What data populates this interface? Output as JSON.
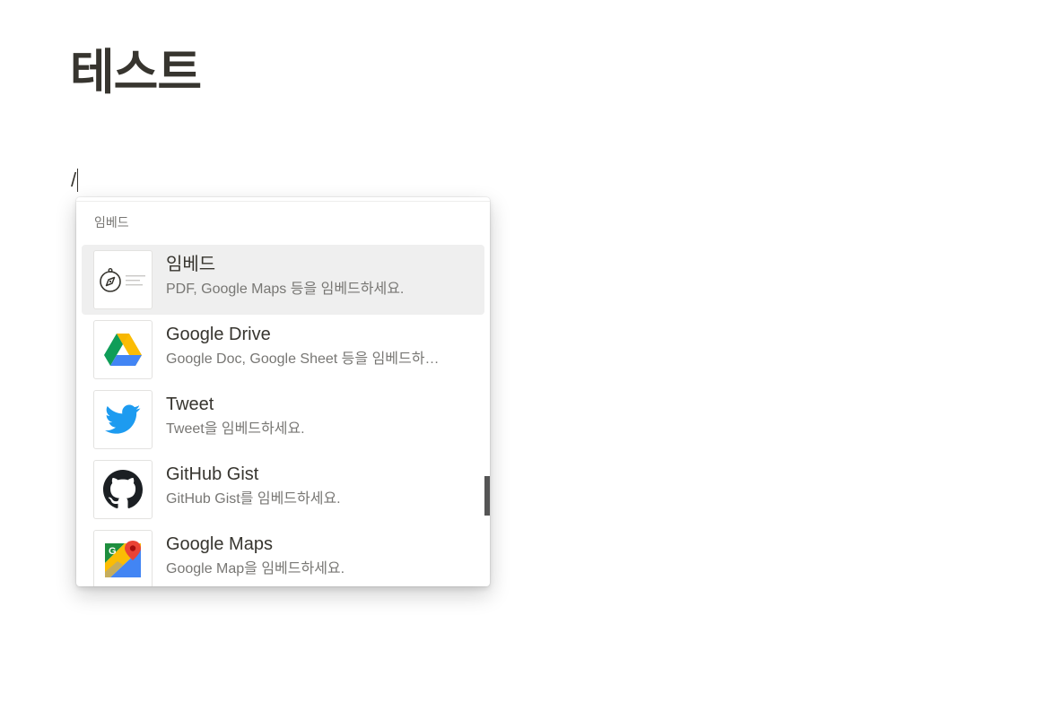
{
  "page": {
    "title": "테스트",
    "input_text": "/"
  },
  "menu": {
    "section_label": "임베드",
    "items": [
      {
        "icon": "embed-compass-icon",
        "title": "임베드",
        "description": "PDF, Google Maps 등을 임베드하세요.",
        "selected": true
      },
      {
        "icon": "google-drive-icon",
        "title": "Google Drive",
        "description": "Google Doc, Google Sheet 등을 임베드하…",
        "selected": false
      },
      {
        "icon": "twitter-bird-icon",
        "title": "Tweet",
        "description": "Tweet을 임베드하세요.",
        "selected": false
      },
      {
        "icon": "github-icon",
        "title": "GitHub Gist",
        "description": "GitHub Gist를 임베드하세요.",
        "selected": false
      },
      {
        "icon": "google-maps-icon",
        "title": "Google Maps",
        "description": "Google Map을 임베드하세요.",
        "selected": false
      }
    ]
  },
  "colors": {
    "text": "#37352f",
    "muted_text": "#787774",
    "selected_bg": "#efefef",
    "twitter_blue": "#1d9bf0"
  }
}
